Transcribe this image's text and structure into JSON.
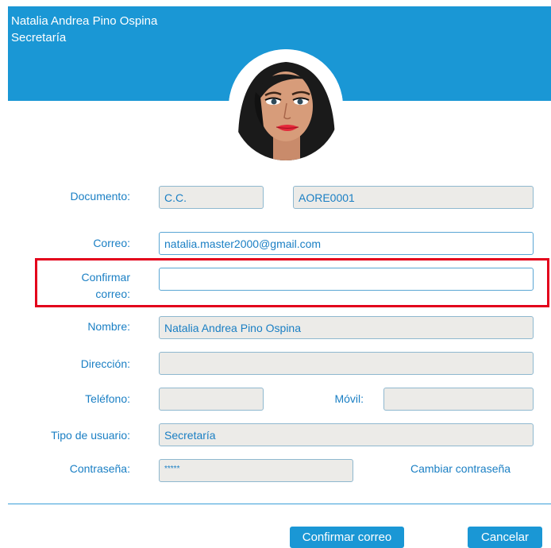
{
  "header": {
    "name": "Natalia Andrea Pino Ospina",
    "role": "Secretaría"
  },
  "form": {
    "documento": {
      "label": "Documento:",
      "type_value": "C.C.",
      "number_value": "AORE0001"
    },
    "correo": {
      "label": "Correo:",
      "value": "natalia.master2000@gmail.com"
    },
    "confirmar_correo": {
      "label_line1": "Confirmar",
      "label_line2": "correo:",
      "value": ""
    },
    "nombre": {
      "label": "Nombre:",
      "value": "Natalia Andrea Pino  Ospina"
    },
    "direccion": {
      "label": "Dirección:",
      "value": ""
    },
    "telefono": {
      "label": "Teléfono:",
      "value": ""
    },
    "movil": {
      "label": "Móvil:",
      "value": ""
    },
    "tipo_usuario": {
      "label": "Tipo de usuario:",
      "value": "Secretaría"
    },
    "contrasena": {
      "label": "Contraseña:",
      "value": "*****",
      "change_link": "Cambiar contraseña"
    }
  },
  "buttons": {
    "confirm": "Confirmar correo",
    "cancel": "Cancelar"
  },
  "colors": {
    "accent": "#1a97d5",
    "highlight": "#e3001b"
  }
}
